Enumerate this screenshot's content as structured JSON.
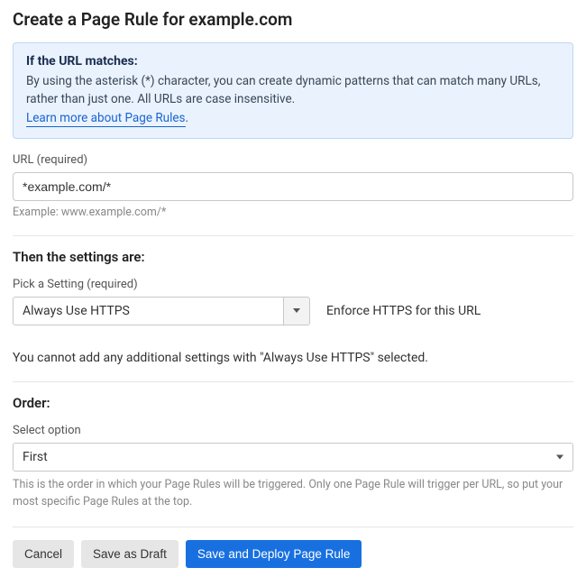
{
  "page_title": "Create a Page Rule for example.com",
  "infobox": {
    "heading": "If the URL matches:",
    "text": "By using the asterisk (*) character, you can create dynamic patterns that can match many URLs, rather than just one. All URLs are case insensitive.",
    "link_text": "Learn more about Page Rules",
    "link_suffix": "."
  },
  "url_field": {
    "label": "URL (required)",
    "value": "*example.com/*",
    "example": "Example: www.example.com/*"
  },
  "settings_section": {
    "heading": "Then the settings are:",
    "pick_label": "Pick a Setting (required)",
    "selected": "Always Use HTTPS",
    "desc": "Enforce HTTPS for this URL",
    "notice": "You cannot add any additional settings with \"Always Use HTTPS\" selected."
  },
  "order_section": {
    "heading": "Order:",
    "select_label": "Select option",
    "selected": "First",
    "help": "This is the order in which your Page Rules will be triggered. Only one Page Rule will trigger per URL, so put your most specific Page Rules at the top."
  },
  "buttons": {
    "cancel": "Cancel",
    "save_draft": "Save as Draft",
    "save_deploy": "Save and Deploy Page Rule"
  }
}
